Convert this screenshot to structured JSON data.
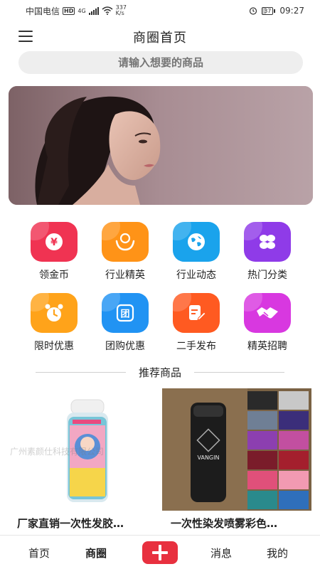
{
  "status_bar": {
    "carrier": "中国电信",
    "hd": "HD",
    "net_gen": "4G",
    "speed_value": "337",
    "speed_unit": "K/s",
    "battery": "37",
    "time": "09:27"
  },
  "header": {
    "title": "商圈首页",
    "menu_icon": "hamburger-menu-icon"
  },
  "search": {
    "placeholder": "请输入想要的商品"
  },
  "grid": [
    {
      "label": "领金币",
      "icon": "coin-icon",
      "color": "#f03352"
    },
    {
      "label": "行业精英",
      "icon": "hands-icon",
      "color": "#ff9317"
    },
    {
      "label": "行业动态",
      "icon": "globe-icon",
      "color": "#1aa3ec"
    },
    {
      "label": "热门分类",
      "icon": "categories-icon",
      "color": "#8f3be8"
    },
    {
      "label": "限时优惠",
      "icon": "alarm-clock-icon",
      "color": "#ffa31a"
    },
    {
      "label": "团购优惠",
      "icon": "group-buy-icon",
      "color": "#2193f3"
    },
    {
      "label": "二手发布",
      "icon": "edit-doc-icon",
      "color": "#ff5a21"
    },
    {
      "label": "精英招聘",
      "icon": "handshake-icon",
      "color": "#d838e0"
    }
  ],
  "recommend": {
    "title": "推荐商品",
    "products": [
      {
        "title": "厂家直销一次性发胶…",
        "watermark": "广州素颜仕科技有限公司"
      },
      {
        "title": "一次性染发喷雾彩色…",
        "brand": "VANGIN"
      }
    ]
  },
  "tabbar": {
    "home": "首页",
    "shop": "商圈",
    "message": "消息",
    "mine": "我的",
    "accent": "#e8303f"
  }
}
